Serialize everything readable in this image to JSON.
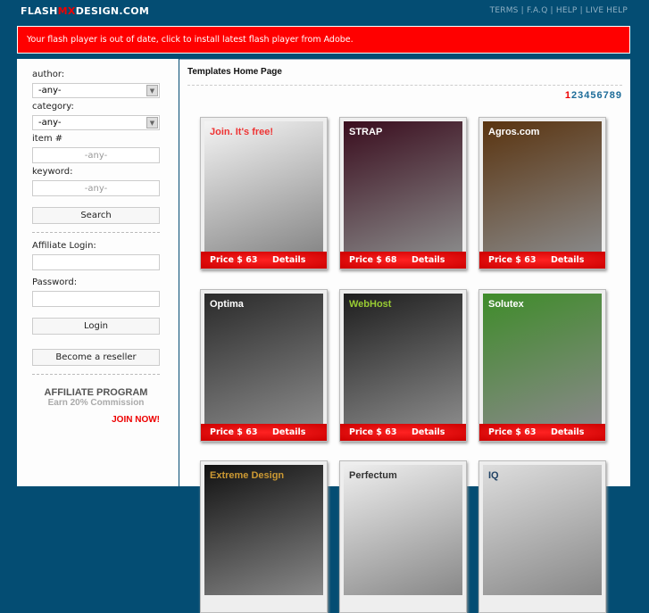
{
  "header": {
    "logo_a": "FLASH",
    "logo_mx": "MX",
    "logo_b": "DESIGN.COM",
    "links": [
      "TERMS",
      "F.A.Q",
      "HELP",
      "LIVE HELP"
    ]
  },
  "banner": "Your flash player is out of date, click to install latest flash player from Adobe.",
  "sidebar": {
    "author_label": "author:",
    "author_value": "-any-",
    "category_label": "category:",
    "category_value": "-any-",
    "item_label": "item #",
    "item_placeholder": "-any-",
    "keyword_label": "keyword:",
    "keyword_placeholder": "-any-",
    "search": "Search",
    "aff_login": "Affiliate Login:",
    "password": "Password:",
    "login": "Login",
    "reseller": "Become a reseller",
    "aff_title": "AFFILIATE PROGRAM",
    "aff_sub": "Earn 20% Commission",
    "aff_join": "JOIN NOW!"
  },
  "main": {
    "title": "Templates Home Page",
    "pages": [
      "1",
      "2",
      "3",
      "4",
      "5",
      "6",
      "7",
      "8",
      "9"
    ],
    "current_page": "1",
    "cards": [
      {
        "price": "Price $ 63",
        "details": "Details",
        "thumb": "Join. It's free!",
        "bg": "#f4f4f4",
        "fg": "#e33"
      },
      {
        "price": "Price $ 68",
        "details": "Details",
        "thumb": "STRAP",
        "bg": "#3a0d1e",
        "fg": "#fff"
      },
      {
        "price": "Price $ 63",
        "details": "Details",
        "thumb": "Agros.com",
        "bg": "#5a3410",
        "fg": "#fff"
      },
      {
        "price": "Price $ 63",
        "details": "Details",
        "thumb": "Optima",
        "bg": "#2a2a2a",
        "fg": "#fff"
      },
      {
        "price": "Price $ 63",
        "details": "Details",
        "thumb": "WebHost",
        "bg": "#1e1e1e",
        "fg": "#9c3"
      },
      {
        "price": "Price $ 63",
        "details": "Details",
        "thumb": "Solutex",
        "bg": "#3f8c2a",
        "fg": "#fff"
      },
      {
        "price": "",
        "details": "",
        "thumb": "Extreme Design",
        "bg": "#111",
        "fg": "#c93"
      },
      {
        "price": "",
        "details": "",
        "thumb": "Perfectum",
        "bg": "#eee",
        "fg": "#333"
      },
      {
        "price": "",
        "details": "",
        "thumb": "IQ",
        "bg": "#ddd",
        "fg": "#246"
      }
    ]
  }
}
